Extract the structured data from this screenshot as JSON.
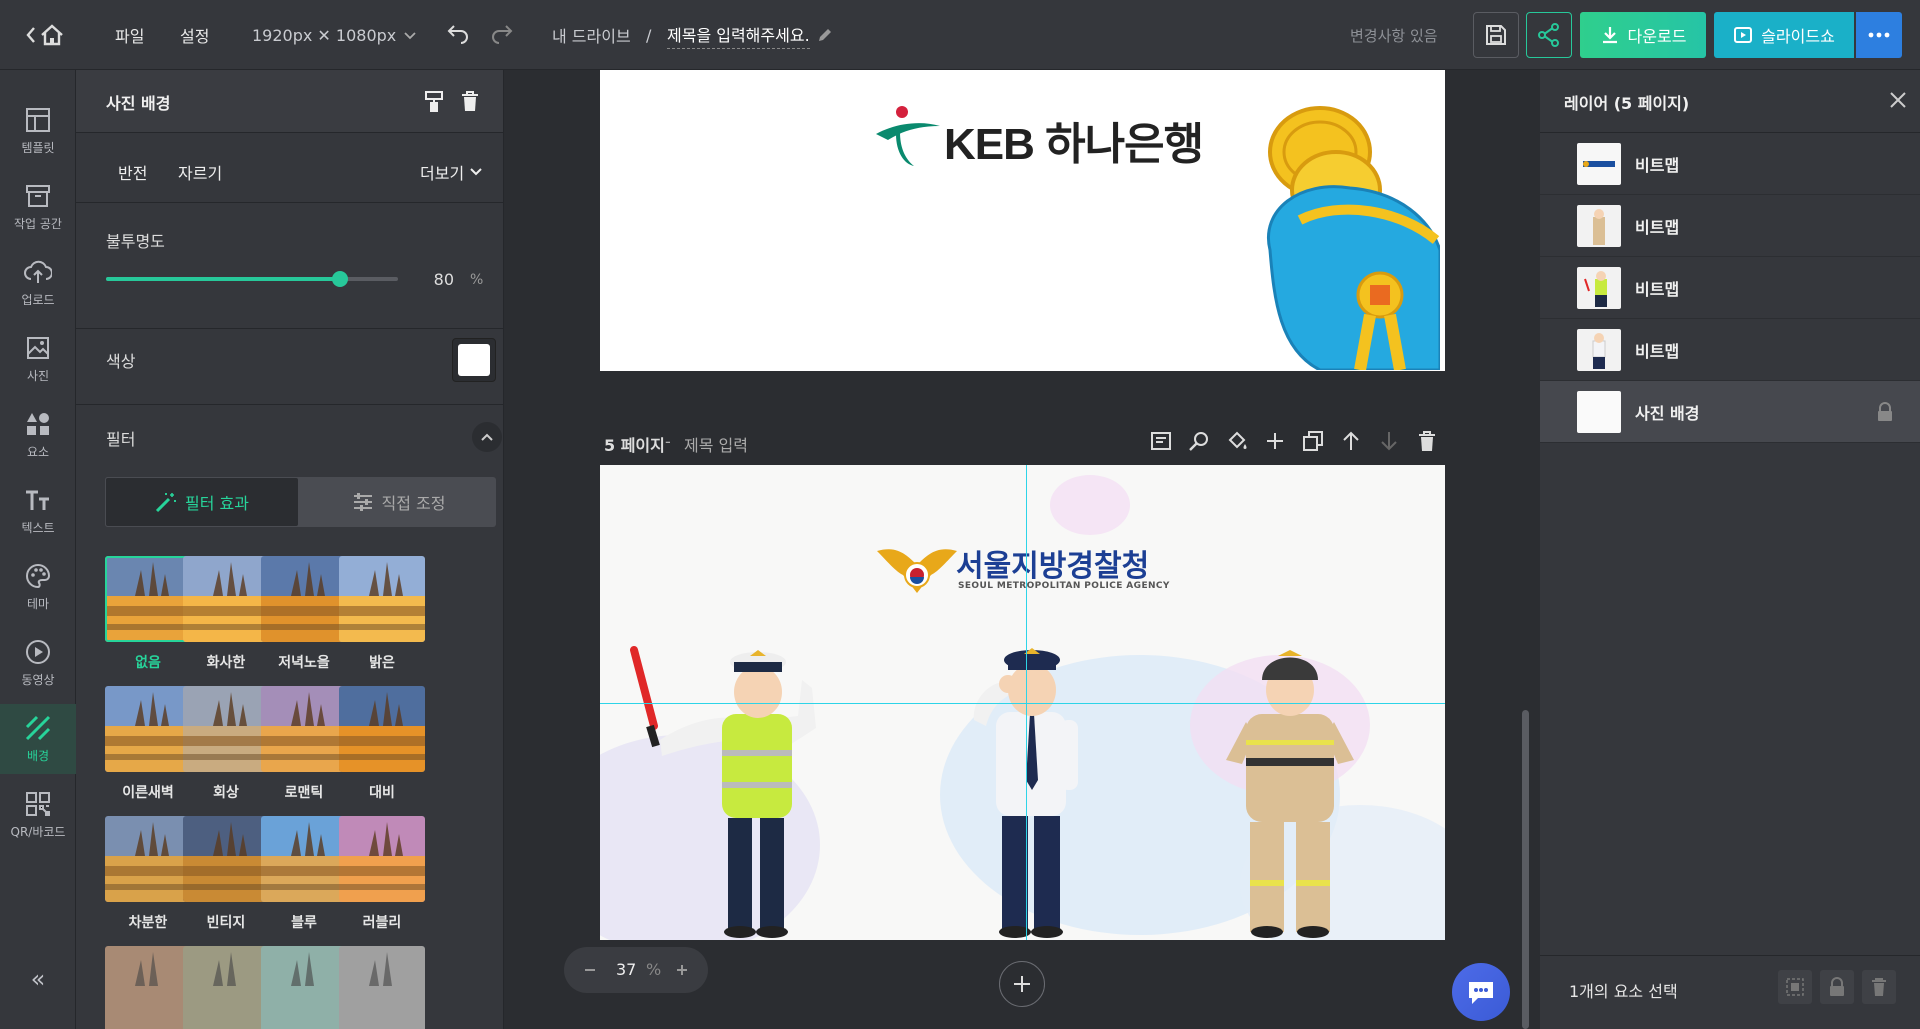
{
  "topbar": {
    "file_label": "파일",
    "settings_label": "설정",
    "size_label": "1920px ✕ 1080px",
    "drive_label": "내 드라이브",
    "separator": "/",
    "title": "제목을 입력해주세요.",
    "status": "변경사항 있음",
    "download_label": "다운로드",
    "slideshow_label": "슬라이드쇼",
    "accent": "#27c89a",
    "slideshow_color": "#1ab0c8"
  },
  "sidebar": {
    "items": [
      {
        "label": "템플릿",
        "icon": "template-icon"
      },
      {
        "label": "작업 공간",
        "icon": "workspace-icon"
      },
      {
        "label": "업로드",
        "icon": "upload-icon"
      },
      {
        "label": "사진",
        "icon": "photo-icon"
      },
      {
        "label": "요소",
        "icon": "elements-icon"
      },
      {
        "label": "텍스트",
        "icon": "text-icon"
      },
      {
        "label": "테마",
        "icon": "theme-icon"
      },
      {
        "label": "동영상",
        "icon": "video-icon"
      },
      {
        "label": "배경",
        "icon": "background-icon"
      },
      {
        "label": "QR/바코드",
        "icon": "qr-icon"
      }
    ],
    "collapse": "«"
  },
  "panel": {
    "header": "사진 배경",
    "flip_label": "반전",
    "crop_label": "자르기",
    "more_label": "더보기",
    "opacity_label": "불투명도",
    "opacity_value": "80",
    "opacity_unit": "%",
    "opacity_fraction": 0.8,
    "color_label": "색상",
    "color_value": "#ffffff",
    "filter_label": "필터",
    "tab_effect": "필터 효과",
    "tab_adjust": "직접 조정",
    "filters": [
      "없음",
      "화사한",
      "저녁노을",
      "밝은",
      "이른새벽",
      "회상",
      "로맨틱",
      "대비",
      "차분한",
      "빈티지",
      "블루",
      "러블리"
    ]
  },
  "canvas": {
    "page_label": "5 페이지",
    "page_title_sep": " - ",
    "page_title": "제목 입력",
    "zoom_value": "37",
    "zoom_unit": "%",
    "bank_logo": "KEB 하나은행",
    "police_title": "서울지방경찰청",
    "police_sub": "SEOUL METROPOLITAN POLICE AGENCY"
  },
  "right": {
    "title": "레이어 (5 페이지)",
    "layers": [
      "비트맵",
      "비트맵",
      "비트맵",
      "비트맵",
      "사진 배경"
    ],
    "selection": "1개의 요소 선택"
  }
}
